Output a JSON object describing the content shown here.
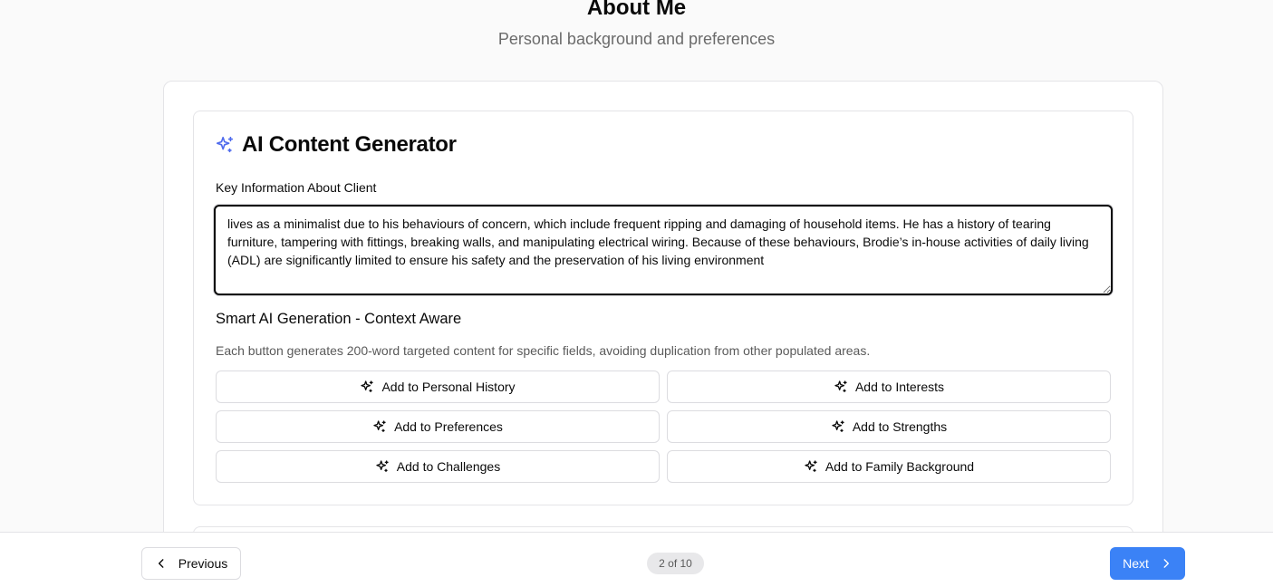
{
  "header": {
    "title": "About Me",
    "subtitle": "Personal background and preferences"
  },
  "generator": {
    "title": "AI Content Generator",
    "icon": "sparkles-icon",
    "accent_color": "#4f6bed",
    "key_info_label": "Key Information About Client",
    "key_info_value": "lives as a minimalist due to his behaviours of concern, which include frequent ripping and damaging of household items. He has a history of tearing furniture, tampering with fittings, breaking walls, and manipulating electrical wiring. Because of these behaviours, Brodie’s in-house activities of daily living (ADL) are significantly limited to ensure his safety and the preservation of his living environment",
    "section_title": "Smart AI Generation - Context Aware",
    "section_description": "Each button generates 200-word targeted content for specific fields, avoiding duplication from other populated areas.",
    "buttons": [
      {
        "label": "Add to Personal History"
      },
      {
        "label": "Add to Interests"
      },
      {
        "label": "Add to Preferences"
      },
      {
        "label": "Add to Strengths"
      },
      {
        "label": "Add to Challenges"
      },
      {
        "label": "Add to Family Background"
      }
    ]
  },
  "footer": {
    "previous_label": "Previous",
    "step_indicator": "2 of 10",
    "next_label": "Next",
    "next_color": "#3b82f6"
  }
}
